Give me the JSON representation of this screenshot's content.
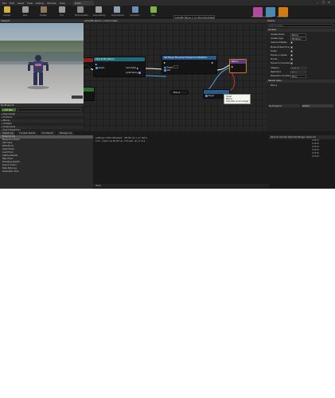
{
  "menu": [
    "File",
    "Edit",
    "Asset",
    "View",
    "Debug",
    "Window",
    "Help"
  ],
  "document_tab": "Actor",
  "window_controls": [
    "–",
    "□",
    "✕"
  ],
  "toolbar": {
    "buttons": [
      {
        "label": "Compile",
        "color": "#d6b03a"
      },
      {
        "label": "Save",
        "color": "#9a9a9a"
      },
      {
        "label": "Browse",
        "color": "#8a7a5a"
      },
      {
        "label": "Find",
        "color": "#9a9a9a"
      },
      {
        "label": "Hide Unrelated",
        "color": "#8a8a8a"
      },
      {
        "label": "Class Settings",
        "color": "#a0a0a0"
      },
      {
        "label": "Class Defaults",
        "color": "#8aa0b8"
      },
      {
        "label": "Simulation",
        "color": "#6a8fb5"
      },
      {
        "label": "Play",
        "color": "#7cb342"
      }
    ],
    "debug_object": "ActionBP_Marine_C_0 in MirrorWorld/DestPrep...",
    "debug_filter_label": "Debug Filter",
    "modes": [
      {
        "label": "Class Defaults",
        "color": "#b04a9a"
      },
      {
        "label": "Viewport",
        "color": "#4a8ab0"
      },
      {
        "label": "Event Graph",
        "color": "#d07a10"
      }
    ]
  },
  "viewport_header": "Viewport",
  "graph": {
    "breadcrumb": "ActionBP_Marine  >  Event Graph",
    "nodes": [
      {
        "title": "Cast To BP_Marine",
        "pins": [
          "Object",
          "Cast Failed",
          "As BP Marine"
        ]
      },
      {
        "title": "Set Player Movement Speed And Rotation",
        "pins": [
          "Target",
          "Self"
        ]
      },
      {
        "title": "Return",
        "pins": [
          "Target"
        ]
      },
      {
        "title": "Marine",
        "pins": []
      }
    ],
    "tooltip": [
      "Target",
      "Marine",
      "Character is not a target"
    ]
  },
  "details": {
    "tab": "Details",
    "search_placeholder": "Search Details",
    "section": "Variable",
    "rows": [
      {
        "label": "Variable Name",
        "value": "Marine"
      },
      {
        "label": "Variable Type",
        "value": "BP Marine"
      },
      {
        "label": "Instance Editable",
        "value": ""
      },
      {
        "label": "Blueprint Read Only",
        "value": ""
      },
      {
        "label": "Tooltip",
        "value": ""
      },
      {
        "label": "Expose on Spawn",
        "value": ""
      },
      {
        "label": "Private",
        "value": ""
      },
      {
        "label": "Expose to Cinematics",
        "value": ""
      },
      {
        "label": "Category",
        "value": "Default"
      },
      {
        "label": "Replication",
        "value": "None"
      },
      {
        "label": "Replication Condition",
        "value": "None"
      }
    ],
    "default_section": "Default Value",
    "default_row": "Marine",
    "lower_tabs": [
      "My Blueprint",
      "Palette"
    ]
  },
  "my_blueprint": {
    "header": "My Blueprint",
    "add_button": "+ Add New",
    "items": [
      "Event Graph",
      "Functions",
      "Macros",
      "Variables",
      "Components",
      "Event Dispatchers"
    ]
  },
  "log": {
    "tabs": [
      "Output Log",
      "Compiler Results",
      "Find Results",
      "Message Log"
    ],
    "categories": [
      "Blueprint Log",
      "Blueprint Compile",
      "Auto Save",
      "EditorErrors",
      "Asset Check",
      "Load Errors",
      "Lighting Results",
      "Map Check",
      "Packaging Results",
      "Source Control",
      "Slate Style Log",
      "Automation Tools"
    ],
    "selected": "Blueprint Log",
    "lines": [
      "LogBlueprintUserMessages: [BP_Marine_C_0] Hello",
      "Info: Compiling BP_Marine finished. No errors."
    ],
    "status": "Show:",
    "right_header": "Name for Cat Actor Object Obj Manager: Report Cat",
    "times": [
      "0:00:01",
      "0:00:02",
      "0:00:03",
      "0:00:04",
      "0:00:05",
      "0:00:06"
    ]
  }
}
